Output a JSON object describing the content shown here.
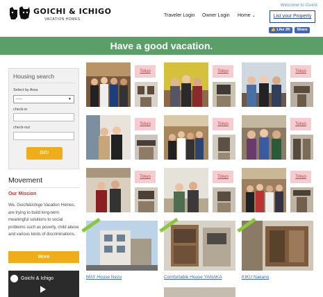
{
  "header": {
    "logo_title": "GOICHI & ICHIGO",
    "logo_subtitle": "VACATION HOMES",
    "logo_mark_text": "goichi & ichigo",
    "welcome": "Welcome to Guest",
    "nav": [
      {
        "label": "Traveler Login"
      },
      {
        "label": "Owner Login"
      },
      {
        "label": "Home",
        "icon": "chevron-down-icon"
      }
    ],
    "list_property": "List your Property",
    "fb_like": "Like 2K",
    "fb_share": "Share"
  },
  "banner": {
    "text": "Have a good vacation."
  },
  "search": {
    "title": "Housing search",
    "area_label": "Select by Area",
    "area_value": "-----",
    "checkin_label": "check-in",
    "checkin_value": "",
    "checkout_label": "check-out",
    "checkout_value": "",
    "go_label": "GO!"
  },
  "movement": {
    "title": "Movement",
    "mission_title": "Our Mission",
    "mission_text": "We, Goichi&Ichigo Vacation Homes, are trying to build long-term meaningful solutions to social problems such as poverty, child abuse and various kinds of discriminations.",
    "more_label": "More",
    "video_title": "Goichi & Ichigo"
  },
  "gallery": {
    "tag": "Tokyo",
    "photo_rows": [
      [
        "Tokyo",
        "Tokyo",
        "Tokyo"
      ],
      [
        "Tokyo",
        "Tokyo",
        "Tokyo"
      ],
      [
        "Tokyo",
        "Tokyo",
        "Tokyo"
      ]
    ],
    "houses": [
      {
        "name": "MAY House Nezu"
      },
      {
        "name": "Comfortable House YANAKA"
      },
      {
        "name": "KIKU Nakano"
      }
    ]
  },
  "colors": {
    "banner": "#5a9e68",
    "accent_button": "#f0ad1a",
    "tag_bg": "#f5cdd0",
    "tag_text": "#c73a3a",
    "link": "#3a6ab8"
  }
}
